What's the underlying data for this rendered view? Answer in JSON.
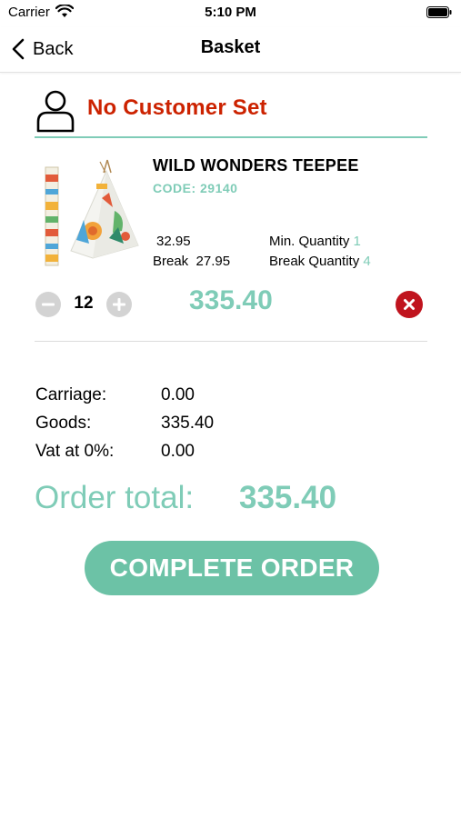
{
  "status_bar": {
    "carrier": "Carrier",
    "time": "5:10 PM"
  },
  "nav": {
    "back_label": "Back",
    "title": "Basket"
  },
  "customer": {
    "label": "No Customer Set"
  },
  "product": {
    "name": "WILD WONDERS TEEPEE",
    "code": "CODE: 29140",
    "price": "32.95",
    "break_label": "Break",
    "break_price": "27.95",
    "min_qty_label": "Min. Quantity",
    "min_qty": "1",
    "break_qty_label": "Break Quantity",
    "break_qty": "4",
    "quantity": "12",
    "line_total": "335.40"
  },
  "summary": {
    "carriage_label": "Carriage:",
    "carriage": "0.00",
    "goods_label": "Goods:",
    "goods": "335.40",
    "vat_label": "Vat at 0%:",
    "vat": "0.00"
  },
  "order_total": {
    "label": "Order total:",
    "value": "335.40"
  },
  "complete_button": {
    "label": "COMPLETE ORDER"
  },
  "colors": {
    "accent": "#7fccb7",
    "button": "#6cc2a6",
    "alert": "#cc2200",
    "remove": "#c0141e"
  }
}
